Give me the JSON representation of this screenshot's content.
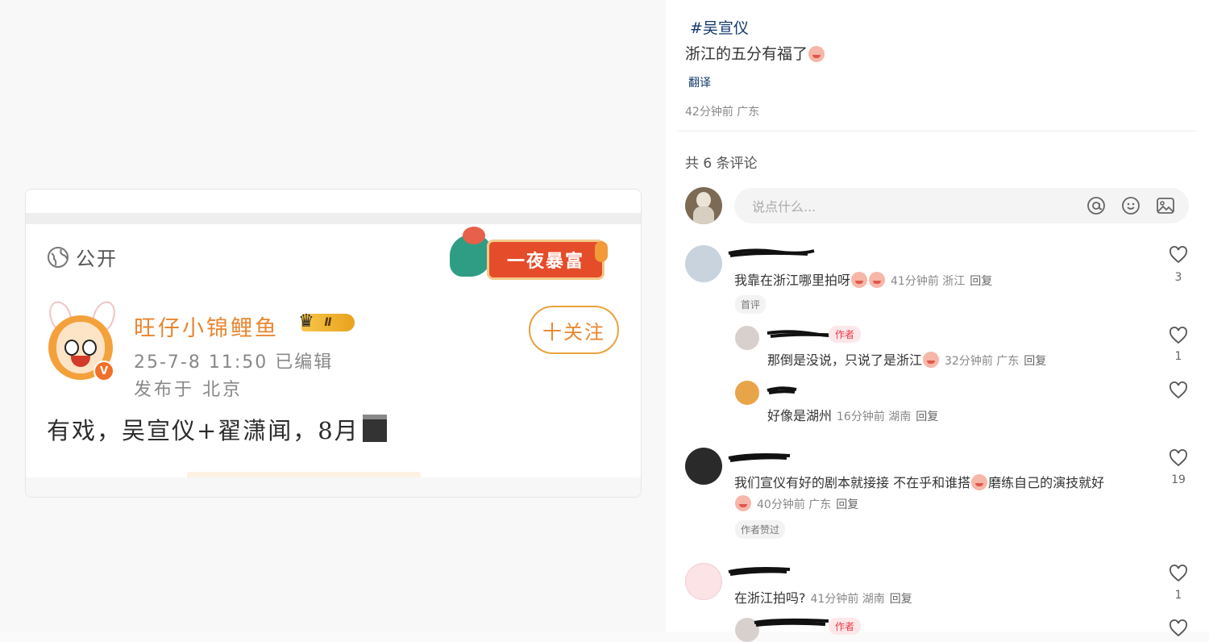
{
  "post_image": {
    "visibility": "公开",
    "banner_text": "一夜暴富",
    "username": "旺仔小锦鲤鱼",
    "level_badge": "Ⅱ",
    "verified_mark": "V",
    "date_line": "25-7-8 11:50  已编辑",
    "location_line": "发布于 北京",
    "follow_label": "十关注",
    "text": "有戏，吴宣仪+翟潇闻，8月"
  },
  "post": {
    "hashtag": "#吴宣仪",
    "body": "浙江的五分有福了",
    "translate": "翻译",
    "time_location": "42分钟前 广东"
  },
  "comments_header": "共 6 条评论",
  "input": {
    "placeholder": "说点什么..."
  },
  "comments": [
    {
      "text": "我靠在浙江哪里拍呀",
      "meta": "41分钟前 浙江",
      "reply": "回复",
      "tag": "首评",
      "likes": "3"
    },
    {
      "text": "那倒是没说，只说了是浙江",
      "meta": "32分钟前 广东",
      "reply": "回复",
      "author_tag": "作者",
      "likes": "1"
    },
    {
      "text": "好像是湖州",
      "meta": "16分钟前 湖南",
      "reply": "回复",
      "likes": ""
    },
    {
      "text": "我们宣仪有好的剧本就接接 不在乎和谁搭",
      "text2": "磨练自己的演技就好",
      "meta": "40分钟前 广东",
      "reply": "回复",
      "tag": "作者赞过",
      "likes": "19"
    },
    {
      "text": "在浙江拍吗?",
      "meta": "41分钟前 湖南",
      "reply": "回复",
      "likes": "1"
    },
    {
      "author_tag": "作者"
    }
  ],
  "colors": {
    "accent_orange": "#e8862e",
    "link_blue": "#13386c",
    "author_red": "#e63a46"
  }
}
